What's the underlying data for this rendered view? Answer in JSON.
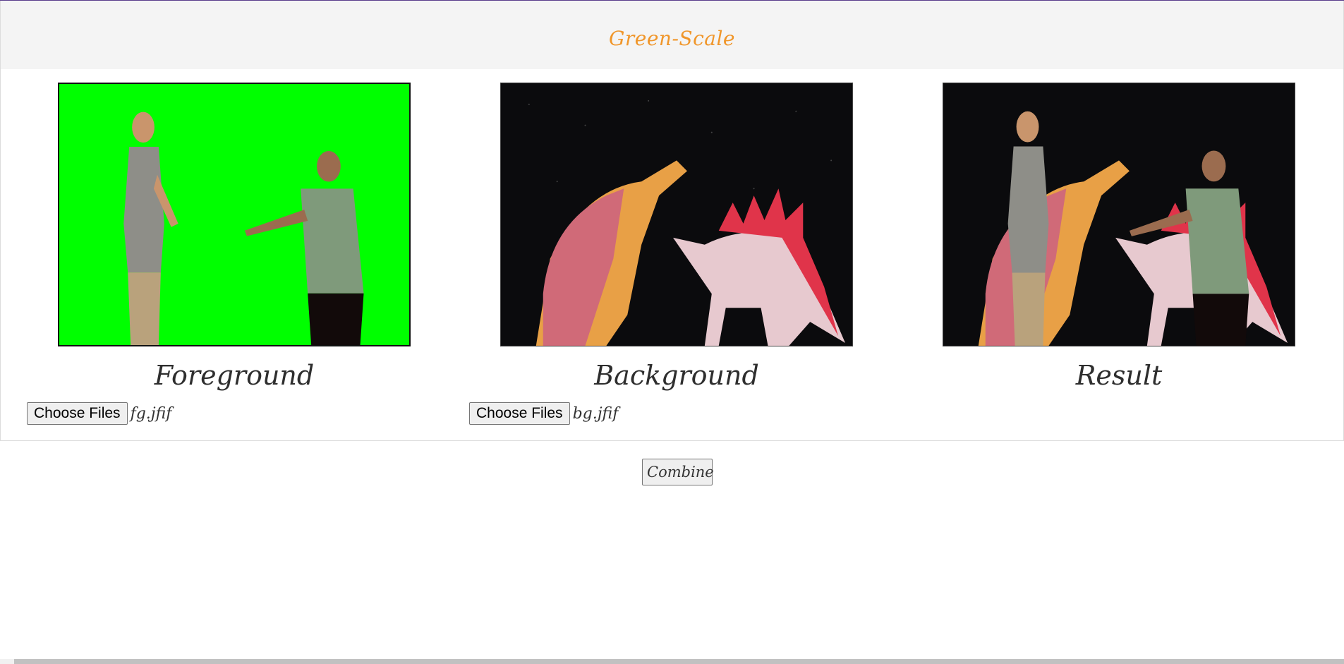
{
  "header": {
    "title": "Green-Scale"
  },
  "panels": [
    {
      "caption": "Foreground",
      "image_icon": "green-screen-people-image",
      "file": {
        "button_label": "Choose Files",
        "file_name": "fg.jfif"
      }
    },
    {
      "caption": "Background",
      "image_icon": "dinosaurs-image",
      "file": {
        "button_label": "Choose Files",
        "file_name": "bg.jfif"
      }
    },
    {
      "caption": "Result",
      "image_icon": "composite-image"
    }
  ],
  "actions": {
    "combine_label": "Combine"
  },
  "colors": {
    "title": "#f0962a",
    "green_screen": "#00ff00",
    "background_dark": "#0b0b0d"
  }
}
